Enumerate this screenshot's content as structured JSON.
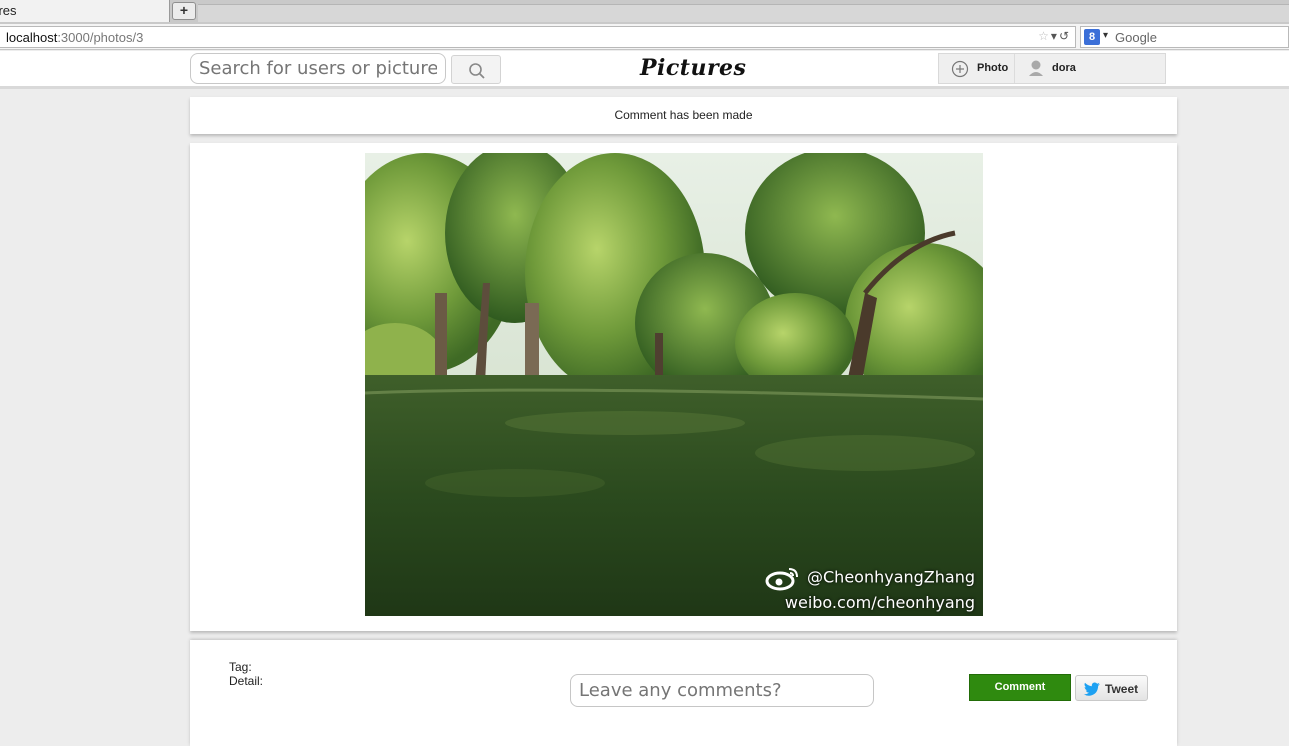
{
  "browser": {
    "tab_title": "'res",
    "new_tab_icon": "plus-icon",
    "url_host": "localhost",
    "url_rest": ":3000/photos/3",
    "search_engine_letter": "8",
    "search_placeholder": "Google"
  },
  "header": {
    "search_placeholder": "Search for users or pictures",
    "brand": "Pictures",
    "photo_button_label": "Photo",
    "user_name": "dora"
  },
  "flash": {
    "message": "Comment has been made"
  },
  "photo": {
    "watermark_handle": "@CheonhyangZhang",
    "watermark_site": "weibo.com/cheonhyang"
  },
  "details": {
    "tag_label": "Tag:",
    "detail_label": "Detail:",
    "comment_placeholder": "Leave any comments?",
    "comment_button": "Comment",
    "tweet_button": "Tweet"
  },
  "colors": {
    "comment_button": "#2f8a0f",
    "twitter_blue": "#1da1f2"
  }
}
